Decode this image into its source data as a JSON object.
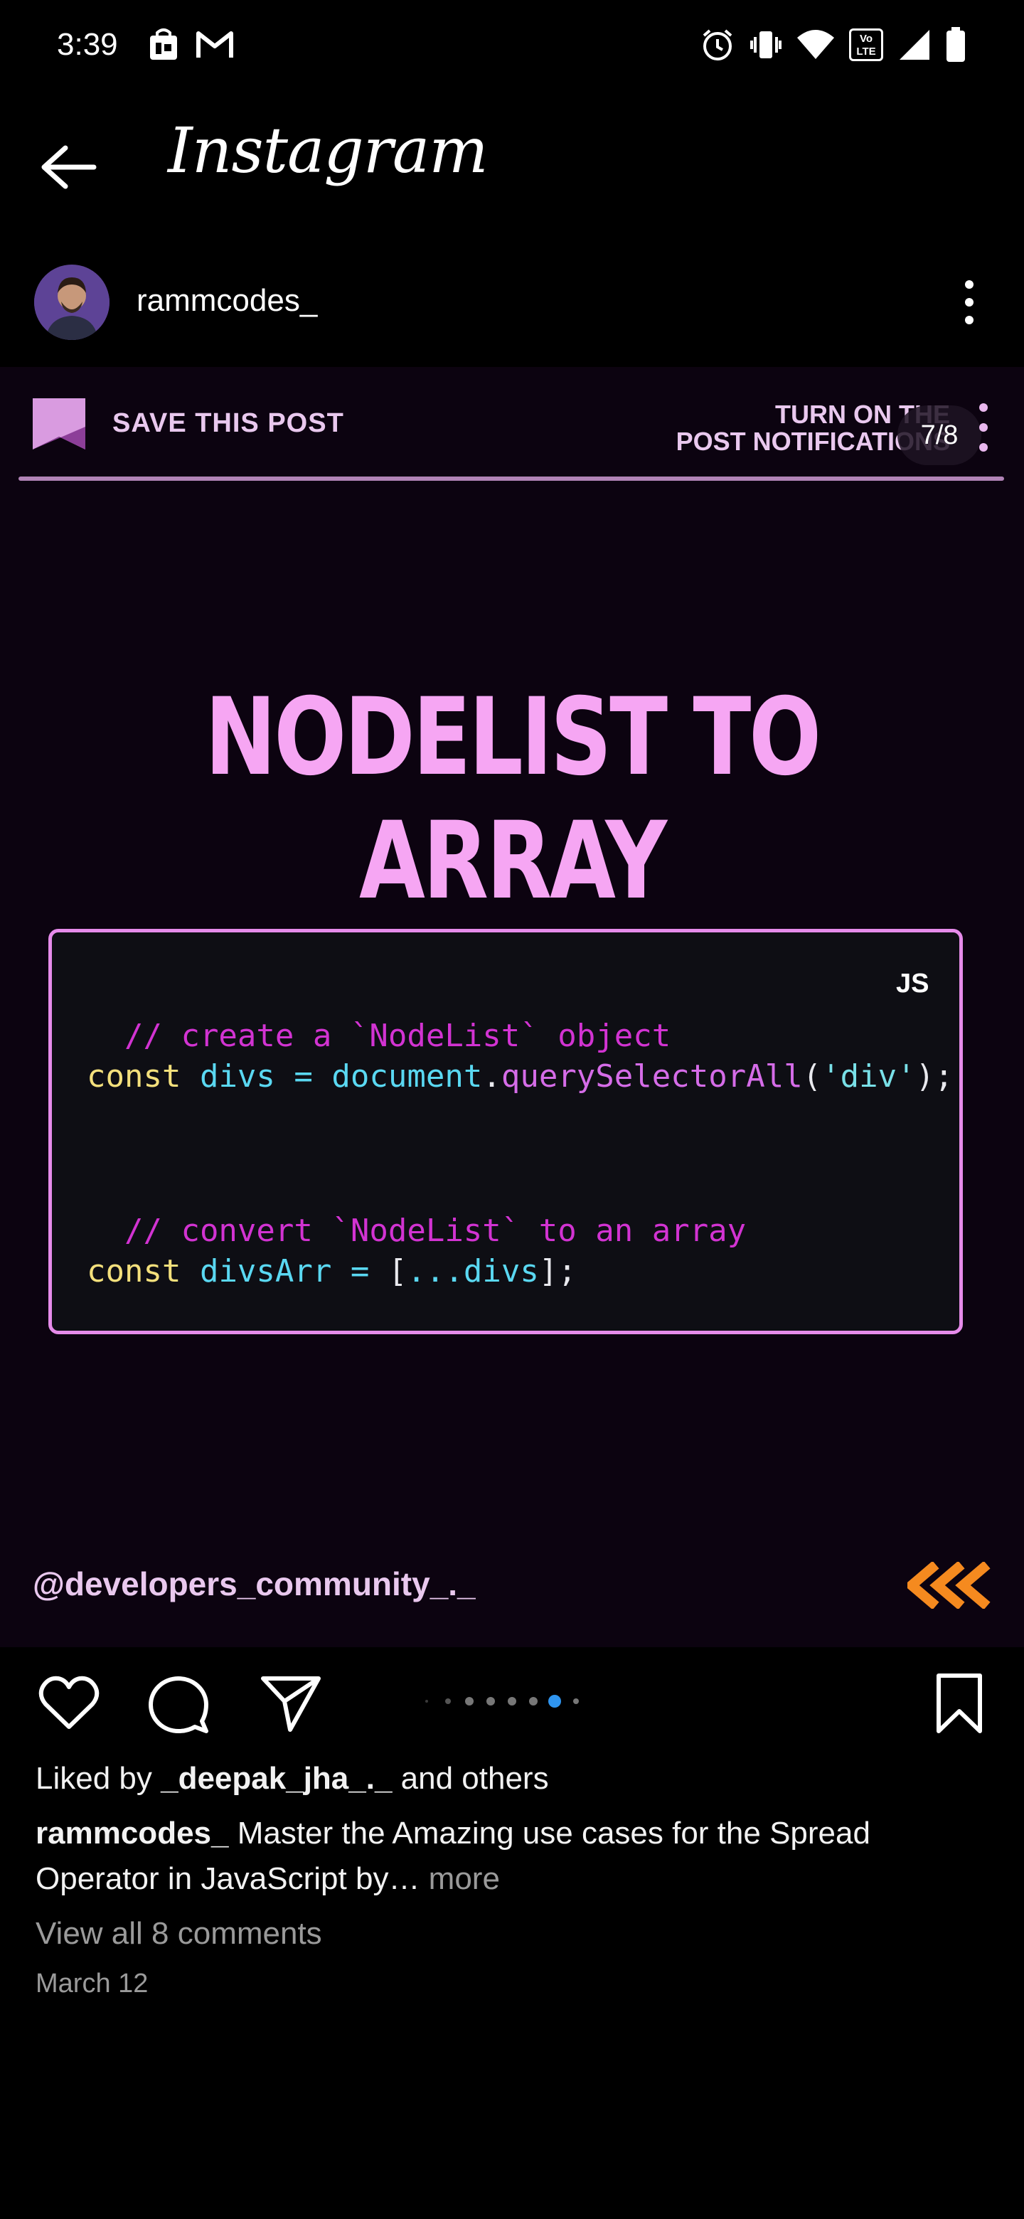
{
  "status_bar": {
    "time": "3:39",
    "left_icons": [
      "shopping-bag-icon",
      "gmail-icon"
    ],
    "right_icons": [
      "alarm-icon",
      "vibrate-icon",
      "wifi-icon",
      "volte-icon",
      "signal-icon",
      "battery-icon"
    ],
    "volte_label": "Vo LTE"
  },
  "header": {
    "app_title": "Instagram"
  },
  "post": {
    "username": "rammcodes_",
    "slide_counter": "7/8",
    "current_slide": 7,
    "total_slides": 8,
    "save_label": "SAVE THIS POST",
    "notify_line1": "TURN ON THE",
    "notify_line2": "POST NOTIFICATIONS",
    "headline": "NODELIST TO ARRAY",
    "code_lang": "JS",
    "code": {
      "line1_comment": "// create a `NodeList` object",
      "line2": {
        "kw": "const",
        "var": "divs",
        "op": "=",
        "obj": "document",
        "dot": ".",
        "fn": "querySelectorAll",
        "p1": "(",
        "str": "'div'",
        "p2": ");"
      },
      "line3_comment": "// convert `NodeList` to an array",
      "line4": {
        "kw": "const",
        "var": "divsArr",
        "op": "=",
        "b1": "[",
        "spread": "...divs",
        "b2": "];"
      }
    },
    "watermark": "@developers_community_._",
    "accent_pink": "#f6a6f3",
    "accent_orange": "#f58a1f"
  },
  "actions": {
    "like_icon": "heart-icon",
    "comment_icon": "comment-icon",
    "share_icon": "send-icon",
    "save_icon": "bookmark-icon"
  },
  "engagement": {
    "liked_prefix": "Liked by ",
    "liked_user": "_deepak_jha_._",
    "liked_suffix": " and others",
    "caption_user": "rammcodes_",
    "caption_text": " Master the Amazing use cases for the Spread Operator in JavaScript by…",
    "caption_more": " more",
    "view_comments": "View all 8 comments",
    "date": "March 12"
  }
}
